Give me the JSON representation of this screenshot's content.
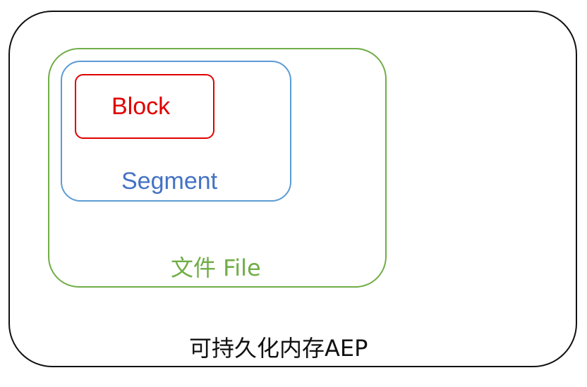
{
  "diagram": {
    "aep": {
      "label": "可持久化内存AEP",
      "color": "#111111"
    },
    "file": {
      "label": "文件 File",
      "color": "#70ad47"
    },
    "segment": {
      "label": "Segment",
      "color": "#4472c4"
    },
    "block": {
      "label": "Block",
      "color": "#e00000"
    }
  }
}
